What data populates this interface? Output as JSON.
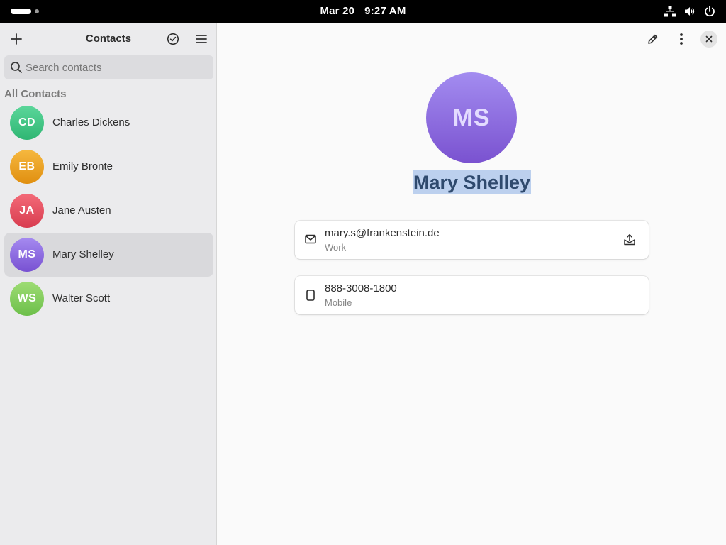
{
  "topbar": {
    "date": "Mar 20",
    "time": "9:27 AM",
    "icons": [
      "activities-indicator",
      "network-icon",
      "volume-icon",
      "power-icon"
    ]
  },
  "sidebar": {
    "title": "Contacts",
    "add_icon": "plus-icon",
    "select_icon": "check-circle-icon",
    "menu_icon": "hamburger-menu-icon",
    "search": {
      "placeholder": "Search contacts",
      "value": ""
    },
    "section_heading": "All Contacts",
    "contacts": [
      {
        "initials": "CD",
        "name": "Charles Dickens",
        "color": "#3cc07f",
        "selected": false
      },
      {
        "initials": "EB",
        "name": "Emily Bronte",
        "color": "#eea525",
        "selected": false
      },
      {
        "initials": "JA",
        "name": "Jane Austen",
        "color": "#e55365",
        "selected": false
      },
      {
        "initials": "MS",
        "name": "Mary Shelley",
        "color": "#8f6be0",
        "selected": true
      },
      {
        "initials": "WS",
        "name": "Walter Scott",
        "color": "#83cd5e",
        "selected": false
      }
    ]
  },
  "detail": {
    "header_icons": [
      "pencil-edit-icon",
      "kebab-menu-icon",
      "close-icon"
    ],
    "initials": "MS",
    "name": "Mary Shelley",
    "avatar_color": "#8f6be0",
    "fields": [
      {
        "icon": "envelope-icon",
        "value": "mary.s@frankenstein.de",
        "label": "Work",
        "action_icon": "send-mail-icon"
      },
      {
        "icon": "phone-icon",
        "value": "888-3008-1800",
        "label": "Mobile"
      }
    ]
  }
}
